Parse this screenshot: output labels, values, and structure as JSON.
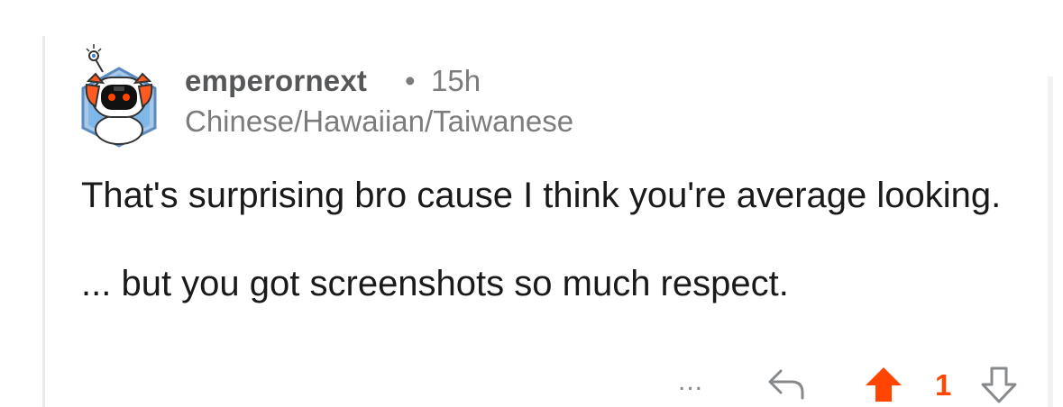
{
  "comment": {
    "username": "emperornext",
    "separator": "•",
    "age": "15h",
    "flair": "Chinese/Hawaiian/Taiwanese",
    "body": [
      "That's surprising bro cause I think you're average looking.",
      "... but you got screenshots so much respect."
    ],
    "score": "1",
    "more_label": "..."
  },
  "colors": {
    "upvote_active": "#ff4500",
    "meta_text": "#7c7c7c",
    "body_text": "#1a1a1b"
  },
  "icons": [
    "reply-icon",
    "upvote-icon",
    "downvote-icon",
    "more-options-icon",
    "avatar"
  ]
}
